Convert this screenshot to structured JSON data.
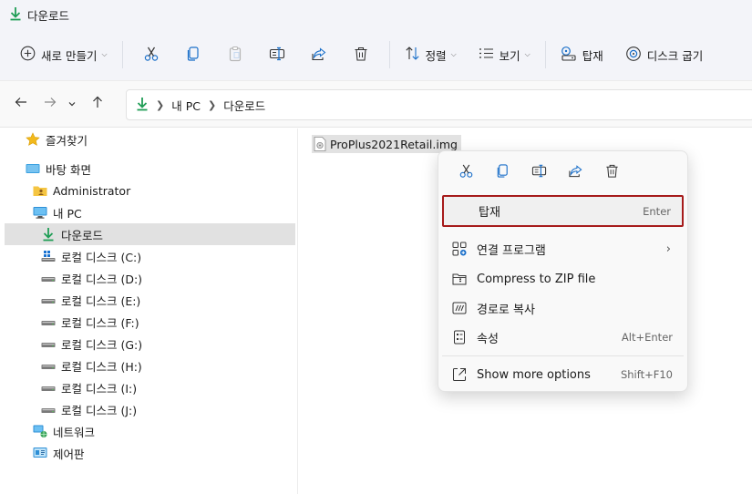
{
  "window": {
    "title": "다운로드"
  },
  "toolbar": {
    "new_label": "새로 만들기",
    "sort_label": "정렬",
    "view_label": "보기",
    "mount_label": "탑재",
    "burn_label": "디스크 굽기"
  },
  "address": {
    "crumbs": [
      "내 PC",
      "다운로드"
    ]
  },
  "sidebar": {
    "quick_access": "즐겨찾기",
    "desktop": "바탕 화면",
    "admin": "Administrator",
    "this_pc": "내 PC",
    "downloads": "다운로드",
    "drives": [
      "로컬 디스크 (C:)",
      "로컬 디스크 (D:)",
      "로컬 디스크 (E:)",
      "로컬 디스크 (F:)",
      "로컬 디스크 (G:)",
      "로컬 디스크 (H:)",
      "로컬 디스크 (I:)",
      "로컬 디스크 (J:)"
    ],
    "network": "네트워크",
    "control_panel": "제어판"
  },
  "content": {
    "file_name": "ProPlus2021Retail.img"
  },
  "context_menu": {
    "mount": {
      "label": "탑재",
      "shortcut": "Enter"
    },
    "open_with": {
      "label": "연결 프로그램"
    },
    "compress": {
      "label": "Compress to ZIP file"
    },
    "copy_path": {
      "label": "경로로 복사"
    },
    "properties": {
      "label": "속성",
      "shortcut": "Alt+Enter"
    },
    "more": {
      "label": "Show more options",
      "shortcut": "Shift+F10"
    }
  },
  "colors": {
    "accent": "#1a6fc9",
    "download_green": "#1f9d55",
    "focus_border": "#a61b1b"
  }
}
